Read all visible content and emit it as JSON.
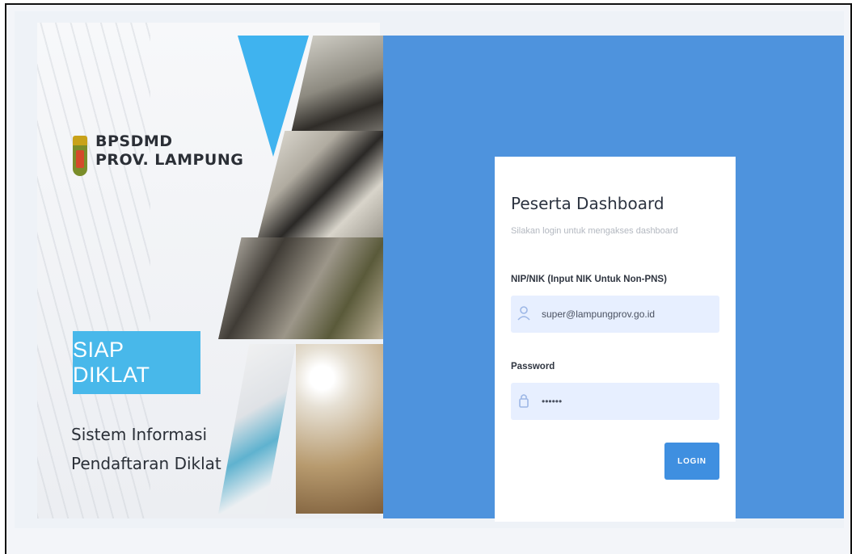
{
  "brand": {
    "line1": "BPSDMD",
    "line2": "PROV. LAMPUNG"
  },
  "hero": {
    "badge": "SIAP DIKLAT",
    "tagline_line1": "Sistem Informasi",
    "tagline_line2": "Pendaftaran Diklat"
  },
  "login": {
    "title": "Peserta Dashboard",
    "subtitle": "Silakan login untuk mengakses dashboard",
    "nip_label": "NIP/NIK (Input NIK Untuk Non-PNS)",
    "nip_value": "super@lampungprov.go.id",
    "password_label": "Password",
    "password_value": "••••••",
    "submit_label": "LOGIN"
  },
  "colors": {
    "panel_blue": "#4e93dd",
    "badge_blue": "#48b8ea",
    "button_blue": "#3f8fe0",
    "field_bg": "#e7efff"
  },
  "icons": {
    "user": "user-icon",
    "lock": "lock-icon",
    "crest": "lampung-crest-icon"
  }
}
